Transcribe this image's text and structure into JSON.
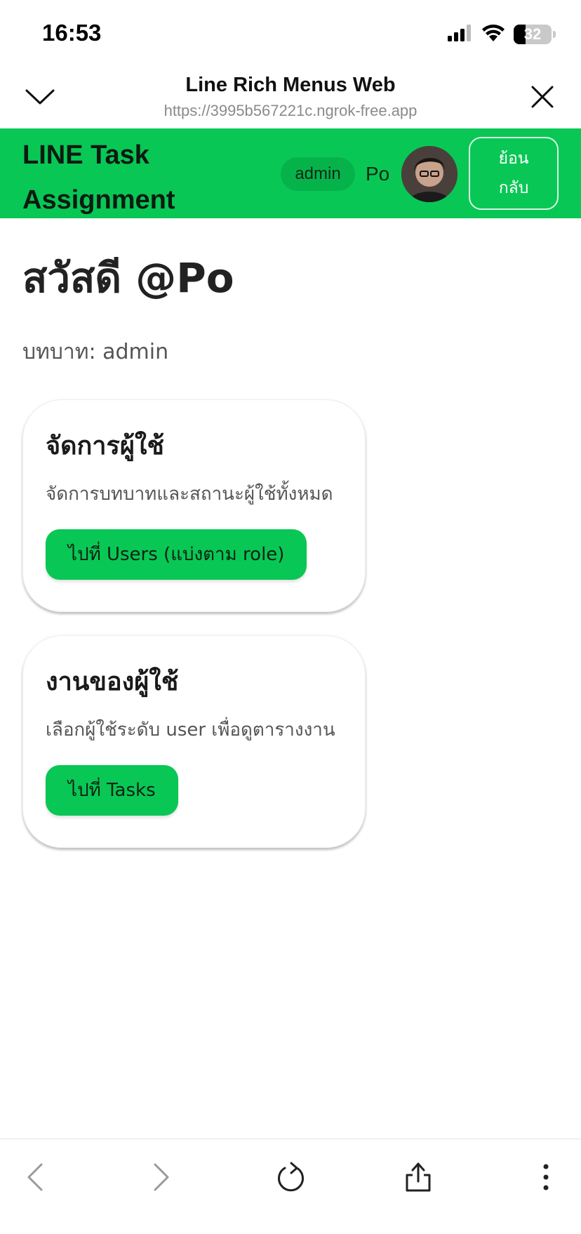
{
  "status_bar": {
    "time": "16:53",
    "battery_level": "32",
    "battery_fraction": 0.32,
    "icons": [
      "signal-icon",
      "wifi-icon",
      "battery-icon"
    ]
  },
  "browser": {
    "title": "Line Rich Menus Web",
    "url": "https://3995b567221c.ngrok-free.app",
    "collapse_icon": "chevron-down-icon",
    "close_icon": "close-icon"
  },
  "app_bar": {
    "title": "LINE Task Assignment",
    "role_badge": "admin",
    "user_name": "Po",
    "back_label": "ย้อนกลับ",
    "color": "#09c755"
  },
  "main": {
    "greeting": "สวัสดี @Po",
    "role_line": "บทบาท: admin"
  },
  "cards": [
    {
      "title": "จัดการผู้ใช้",
      "description": "จัดการบทบาทและสถานะผู้ใช้ทั้งหมด",
      "button": "ไปที่ Users (แบ่งตาม role)"
    },
    {
      "title": "งานของผู้ใช้",
      "description": "เลือกผู้ใช้ระดับ user เพื่อดูตารางงาน",
      "button": "ไปที่ Tasks"
    }
  ],
  "toolbar": {
    "icons": [
      "back-icon",
      "forward-icon",
      "reload-icon",
      "share-icon",
      "more-icon"
    ]
  }
}
